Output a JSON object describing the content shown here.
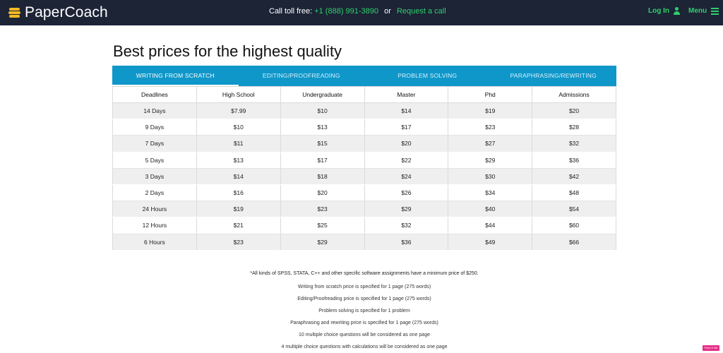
{
  "header": {
    "logo_text": "PaperCoach",
    "call_label": "Call toll free:",
    "phone": "+1 (888) 991-3890",
    "or_label": "or",
    "request_call": "Request a call",
    "login_label": "Log In",
    "menu_label": "Menu"
  },
  "page": {
    "title": "Best prices for the highest quality"
  },
  "tabs": [
    {
      "label": "WRITING FROM SCRATCH",
      "active": true
    },
    {
      "label": "EDITING/PROOFREADING",
      "active": false
    },
    {
      "label": "PROBLEM SOLVING",
      "active": false
    },
    {
      "label": "PARAPHRASING/REWRITING",
      "active": false
    }
  ],
  "table": {
    "headers": [
      "Deadlines",
      "High School",
      "Undergraduate",
      "Master",
      "Phd",
      "Admissions"
    ],
    "rows": [
      [
        "14 Days",
        "$7.99",
        "$10",
        "$14",
        "$19",
        "$20"
      ],
      [
        "9 Days",
        "$10",
        "$13",
        "$17",
        "$23",
        "$28"
      ],
      [
        "7 Days",
        "$11",
        "$15",
        "$20",
        "$27",
        "$32"
      ],
      [
        "5 Days",
        "$13",
        "$17",
        "$22",
        "$29",
        "$36"
      ],
      [
        "3 Days",
        "$14",
        "$18",
        "$24",
        "$30",
        "$42"
      ],
      [
        "2 Days",
        "$16",
        "$20",
        "$26",
        "$34",
        "$48"
      ],
      [
        "24 Hours",
        "$19",
        "$23",
        "$29",
        "$40",
        "$54"
      ],
      [
        "12 Hours",
        "$21",
        "$25",
        "$32",
        "$44",
        "$60"
      ],
      [
        "6 Hours",
        "$23",
        "$29",
        "$36",
        "$49",
        "$66"
      ]
    ]
  },
  "notes": [
    "*All kinds of SPSS, STATA, C++ and other specific software assignments have a minimum price of $250.",
    "Writing from scratch price is specified for 1 page (275 words)",
    "Editing/Proofreading price is specified for 1 page (275 words)",
    "Problem solving is specified for 1 problem",
    "Paraphrasing and rewriting price is specified for 1 page (275 words)",
    "10 multiple choice questions will be considered as one page",
    "4 multiple choice questions with calculations will be considered as one page"
  ],
  "badge": {
    "label": "Point it We"
  },
  "colors": {
    "header_bg": "#1c2436",
    "accent_green": "#2fd06b",
    "tab_bar": "#0f97c9",
    "logo_gold": "#f5b922"
  }
}
